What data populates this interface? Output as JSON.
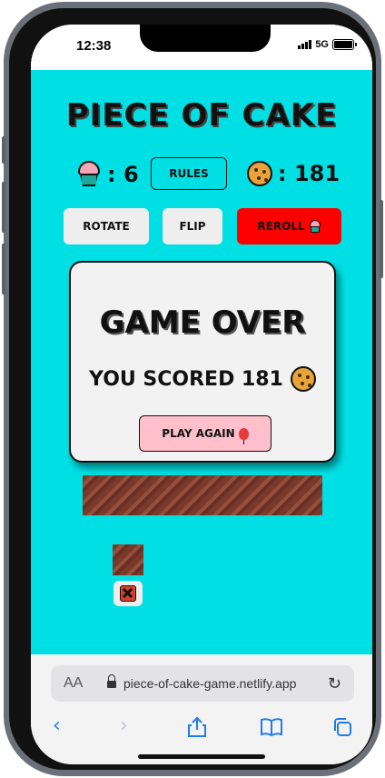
{
  "status_bar": {
    "time": "12:38",
    "network": "5G"
  },
  "game": {
    "title": "PIECE OF CAKE",
    "cupcakes_label": ": 6",
    "rules_label": "RULES",
    "cookies_label": ": 181",
    "rotate_label": "ROTATE",
    "flip_label": "FLIP",
    "reroll_label": "REROLL"
  },
  "modal": {
    "title": "GAME OVER",
    "score_text": "YOU SCORED 181",
    "play_again_label": "PLAY AGAIN"
  },
  "browser": {
    "text_size_label": "AA",
    "url": "piece-of-cake-game.netlify.app"
  },
  "colors": {
    "game_background": "#00e0e4",
    "reroll_button": "#ff0000",
    "play_again_button": "#ffc0cb",
    "browser_accent": "#1f7cf0"
  }
}
